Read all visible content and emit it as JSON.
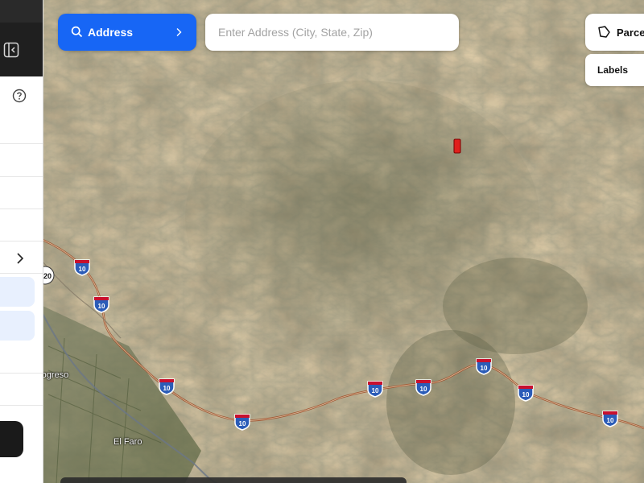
{
  "toolbar": {
    "address_label": "Address",
    "address_placeholder": "Enter Address (City, State, Zip)",
    "parcels_label": "Parce",
    "labels_label": "Labels"
  },
  "map": {
    "highways": [
      {
        "label": "10"
      },
      {
        "label": "10"
      },
      {
        "label": "10"
      },
      {
        "label": "10"
      },
      {
        "label": "10"
      },
      {
        "label": "10"
      },
      {
        "label": "10"
      },
      {
        "label": "10"
      },
      {
        "label": "10"
      }
    ],
    "partial_route_label": "20",
    "places": [
      "rogreso",
      "El Faro"
    ]
  },
  "colors": {
    "accent": "#1766f5",
    "parcel_marker": "#e0201c",
    "highway_shield": "#2b5cb8"
  }
}
